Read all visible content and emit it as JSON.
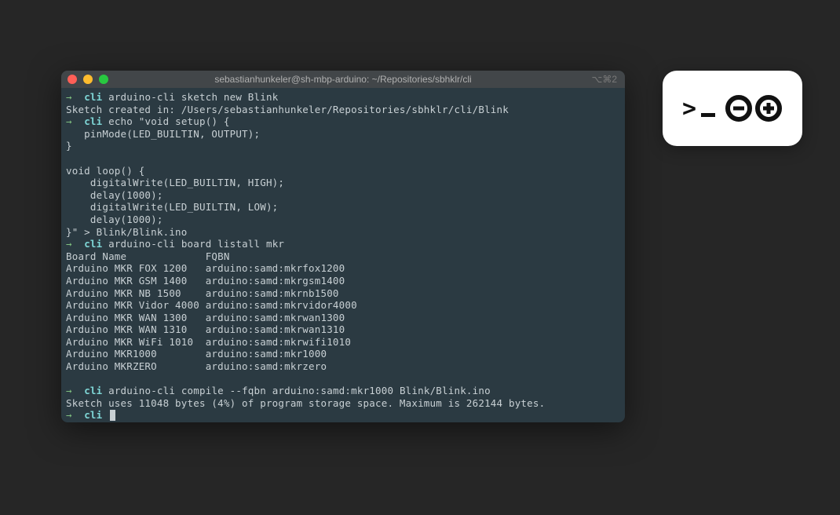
{
  "window": {
    "title": "sebastianhunkeler@sh-mbp-arduino: ~/Repositories/sbhklr/cli",
    "shortcut": "⌥⌘2"
  },
  "prompt": {
    "arrow": "→",
    "dir": "cli"
  },
  "lines": {
    "l1_cmd": "arduino-cli sketch new Blink",
    "l2": "Sketch created in: /Users/sebastianhunkeler/Repositories/sbhklr/cli/Blink",
    "l3_cmd": "echo \"void setup() {",
    "l4": "   pinMode(LED_BUILTIN, OUTPUT);",
    "l5": "}",
    "l6": "",
    "l7": "void loop() {",
    "l8": "    digitalWrite(LED_BUILTIN, HIGH);",
    "l9": "    delay(1000);",
    "l10": "    digitalWrite(LED_BUILTIN, LOW);",
    "l11": "    delay(1000);",
    "l12": "}\" > Blink/Blink.ino",
    "l13_cmd": "arduino-cli board listall mkr",
    "l14": "Board Name             FQBN",
    "l15": "Arduino MKR FOX 1200   arduino:samd:mkrfox1200",
    "l16": "Arduino MKR GSM 1400   arduino:samd:mkrgsm1400",
    "l17": "Arduino MKR NB 1500    arduino:samd:mkrnb1500",
    "l18": "Arduino MKR Vidor 4000 arduino:samd:mkrvidor4000",
    "l19": "Arduino MKR WAN 1300   arduino:samd:mkrwan1300",
    "l20": "Arduino MKR WAN 1310   arduino:samd:mkrwan1310",
    "l21": "Arduino MKR WiFi 1010  arduino:samd:mkrwifi1010",
    "l22": "Arduino MKR1000        arduino:samd:mkr1000",
    "l23": "Arduino MKRZERO        arduino:samd:mkrzero",
    "l24": "",
    "l25_cmd": "arduino-cli compile --fqbn arduino:samd:mkr1000 Blink/Blink.ino",
    "l26": "Sketch uses 11048 bytes (4%) of program storage space. Maximum is 262144 bytes."
  },
  "logo": {
    "prompt_symbol": ">"
  }
}
